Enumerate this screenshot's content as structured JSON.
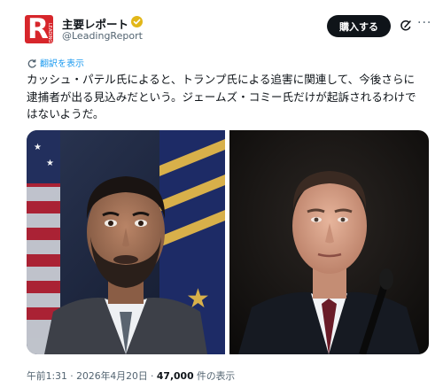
{
  "account": {
    "display_name": "主要レポート",
    "handle": "@LeadingReport",
    "avatar_letter": "R",
    "avatar_tagline": "LEADING",
    "brand_color": "#d7262b",
    "verified_color": "#e2b719"
  },
  "header": {
    "subscribe_label": "購入する",
    "grok_icon": "grok-icon",
    "more_icon": "more-icon"
  },
  "post": {
    "translate_label": "翻訳を表示",
    "text": "カッシュ・パテル氏によると、トランプ氏による追害に関連して、今後さらに逮捕者が出る見込みだという。ジェームズ・コミー氏だけが起訴されるわけではないようだ。"
  },
  "media": {
    "photos": [
      {
        "subject": "man in dark suit in front of flags"
      },
      {
        "subject": "man in dark suit at hearing microphone"
      }
    ]
  },
  "meta": {
    "time": "午前1:31",
    "separator_1": " · ",
    "date": "2026年4月20日",
    "separator_2": " · ",
    "views": "47,000",
    "views_suffix": " 件の表示"
  }
}
